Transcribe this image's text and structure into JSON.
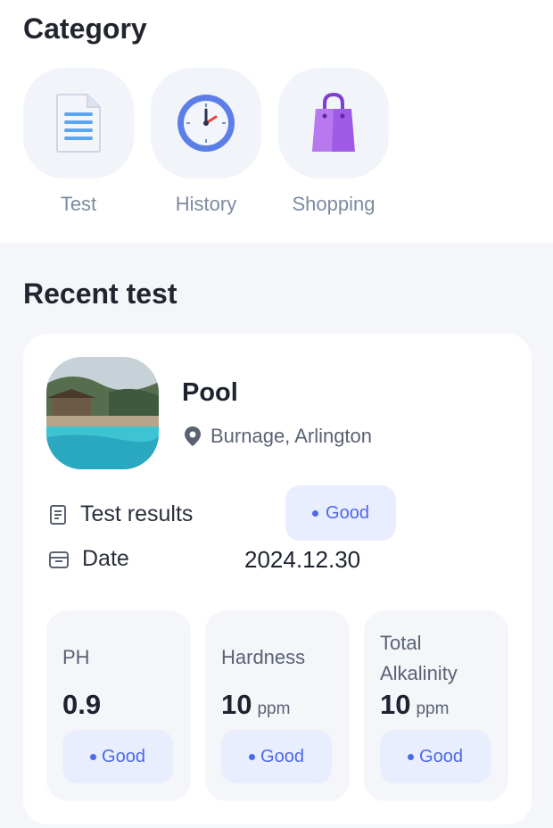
{
  "category": {
    "title": "Category",
    "items": [
      {
        "label": "Test",
        "icon": "document-icon"
      },
      {
        "label": "History",
        "icon": "clock-icon"
      },
      {
        "label": "Shopping",
        "icon": "shopping-bag-icon"
      }
    ]
  },
  "recent": {
    "title": "Recent test",
    "card": {
      "name": "Pool",
      "location": "Burnage, Arlington",
      "results_label": "Test results",
      "results_status": "Good",
      "date_label": "Date",
      "date_value": "2024.12.30",
      "metrics": [
        {
          "label": "PH",
          "value": "0.9",
          "unit": "",
          "status": "Good"
        },
        {
          "label": "Hardness",
          "value": "10",
          "unit": "ppm",
          "status": "Good"
        },
        {
          "label": "Total Alkalinity",
          "value": "10",
          "unit": "ppm",
          "status": "Good"
        }
      ]
    }
  },
  "colors": {
    "accent": "#4d68e8",
    "pill_bg": "#e9eefe",
    "muted_text": "#7d8aa0"
  }
}
